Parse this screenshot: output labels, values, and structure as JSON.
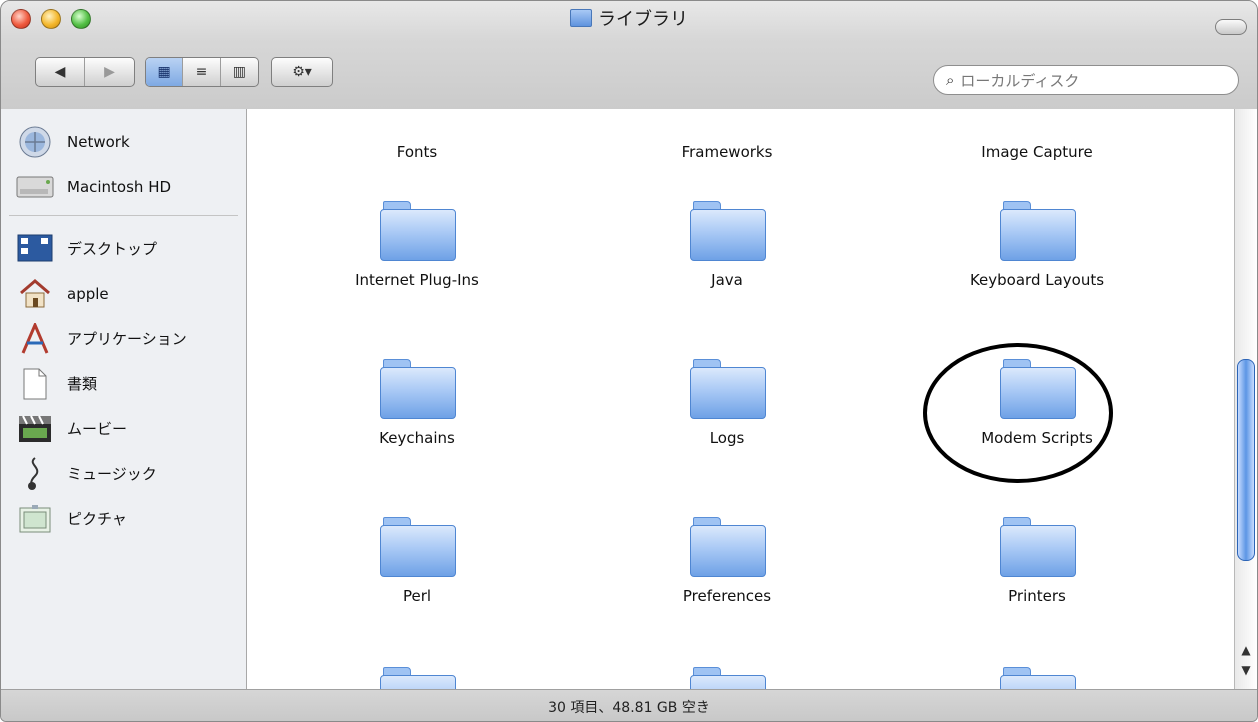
{
  "window": {
    "title": "ライブラリ"
  },
  "toolbar": {
    "back_label": "◀",
    "forward_label": "▶",
    "views": [
      {
        "label": "▦",
        "name": "icon-view"
      },
      {
        "label": "≡",
        "name": "list-view"
      },
      {
        "label": "▥",
        "name": "column-view"
      }
    ],
    "action_label": "⚙▾",
    "search": {
      "icon": "search-icon",
      "placeholder": "ローカルディスク"
    }
  },
  "sidebar": {
    "devices": [
      {
        "label": "Network",
        "icon": "network-icon"
      },
      {
        "label": "Macintosh HD",
        "icon": "hard-drive-icon"
      }
    ],
    "places": [
      {
        "label": "デスクトップ",
        "icon": "desktop-icon"
      },
      {
        "label": "apple",
        "icon": "home-icon"
      },
      {
        "label": "アプリケーション",
        "icon": "applications-icon"
      },
      {
        "label": "書類",
        "icon": "documents-icon"
      },
      {
        "label": "ムービー",
        "icon": "movies-icon"
      },
      {
        "label": "ミュージック",
        "icon": "music-icon"
      },
      {
        "label": "ピクチャ",
        "icon": "pictures-icon"
      }
    ]
  },
  "files": [
    {
      "label": "Fonts"
    },
    {
      "label": "Frameworks"
    },
    {
      "label": "Image Capture"
    },
    {
      "label": "Internet Plug-Ins"
    },
    {
      "label": "Java"
    },
    {
      "label": "Keyboard Layouts"
    },
    {
      "label": "Keychains"
    },
    {
      "label": "Logs"
    },
    {
      "label": "Modem Scripts"
    },
    {
      "label": "Perl"
    },
    {
      "label": "Preferences"
    },
    {
      "label": "Printers"
    }
  ],
  "status": {
    "text": "30 項目、48.81 GB 空き"
  },
  "colors": {
    "folder_blue": "#6ea1e6",
    "scroll_thumb": "#5c96e5"
  }
}
